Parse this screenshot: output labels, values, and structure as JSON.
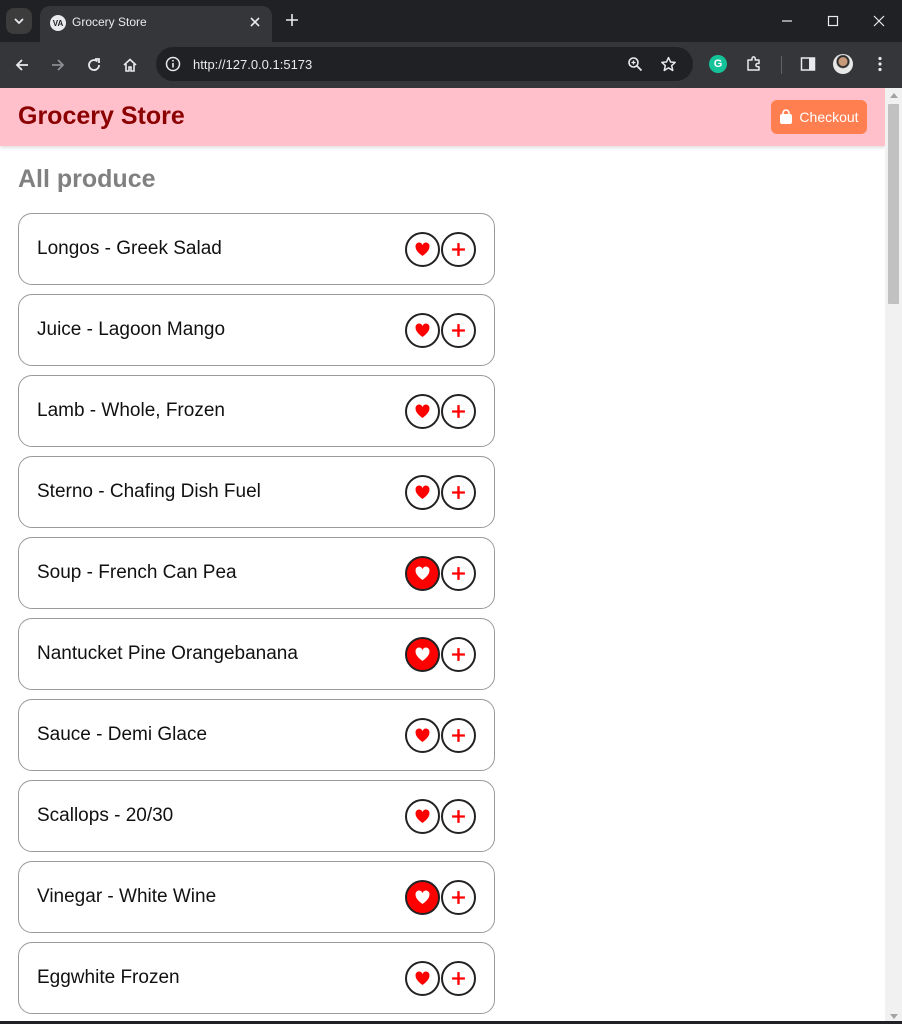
{
  "browser": {
    "tab_title": "Grocery Store",
    "favicon_text": "VA",
    "url": "http://127.0.0.1:5173",
    "grammarly_label": "G"
  },
  "app": {
    "brand": "Grocery Store",
    "checkout_label": "Checkout",
    "section_title": "All produce",
    "colors": {
      "header_bg": "#ffc0cb",
      "brand_text": "#8b0000",
      "checkout_bg": "#ff7f50",
      "heart": "#ff0000"
    }
  },
  "items": [
    {
      "name": "Longos - Greek Salad",
      "favorited": false
    },
    {
      "name": "Juice - Lagoon Mango",
      "favorited": false
    },
    {
      "name": "Lamb - Whole, Frozen",
      "favorited": false
    },
    {
      "name": "Sterno - Chafing Dish Fuel",
      "favorited": false
    },
    {
      "name": "Soup - French Can Pea",
      "favorited": true
    },
    {
      "name": "Nantucket Pine Orangebanana",
      "favorited": true
    },
    {
      "name": "Sauce - Demi Glace",
      "favorited": false
    },
    {
      "name": "Scallops - 20/30",
      "favorited": false
    },
    {
      "name": "Vinegar - White Wine",
      "favorited": true
    },
    {
      "name": "Eggwhite Frozen",
      "favorited": false
    }
  ]
}
